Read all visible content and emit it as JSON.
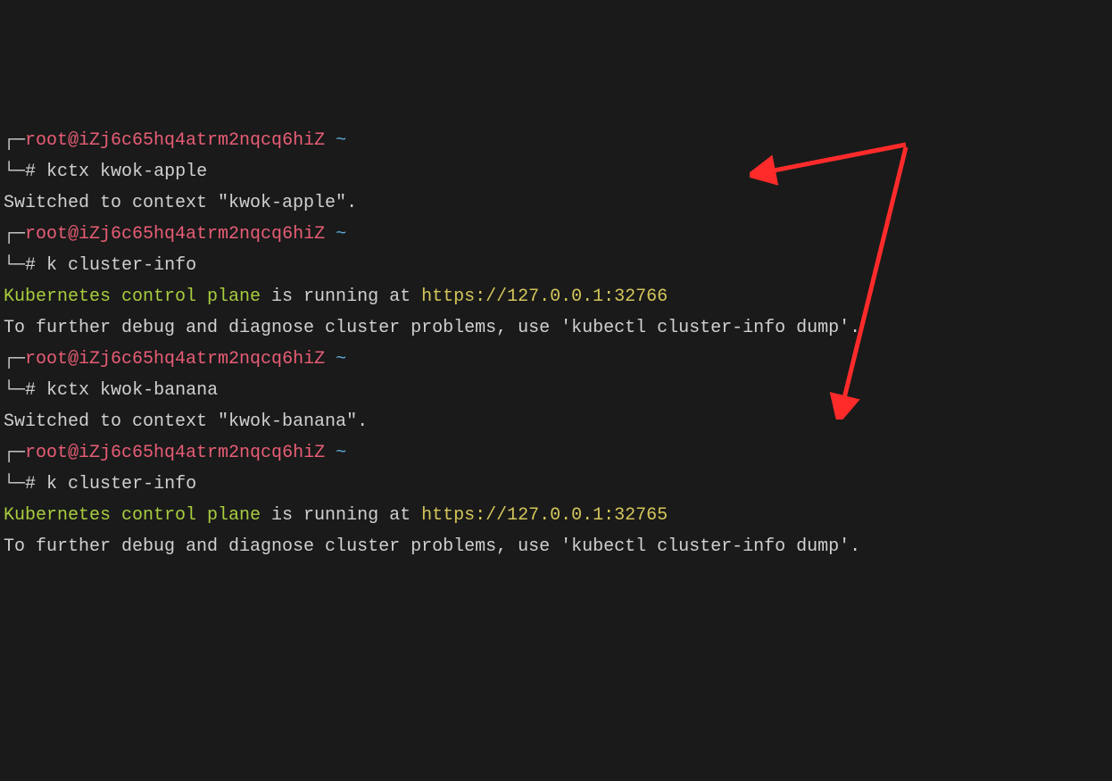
{
  "prompt": {
    "bracket_top": "┌─",
    "bracket_bot": "└─",
    "user_host": "root@iZj6c65hq4atrm2nqcq6hiZ",
    "tilde": "~",
    "hash": "#"
  },
  "blocks": [
    {
      "command": "kctx kwok-apple",
      "output_plain": [
        "Switched to context \"kwok-apple\"."
      ]
    },
    {
      "command": "k cluster-info",
      "cluster_info": {
        "prefix": "Kubernetes control plane",
        "mid": " is running at ",
        "url": "https://127.0.0.1:32766"
      },
      "output_plain": [
        "",
        "To further debug and diagnose cluster problems, use 'kubectl cluster-info dump'."
      ]
    },
    {
      "command": "kctx kwok-banana",
      "output_plain": [
        "Switched to context \"kwok-banana\"."
      ]
    },
    {
      "command": "k cluster-info",
      "cluster_info": {
        "prefix": "Kubernetes control plane",
        "mid": " is running at ",
        "url": "https://127.0.0.1:32765"
      },
      "output_plain": [
        "",
        "To further debug and diagnose cluster problems, use 'kubectl cluster-info dump'."
      ]
    }
  ]
}
